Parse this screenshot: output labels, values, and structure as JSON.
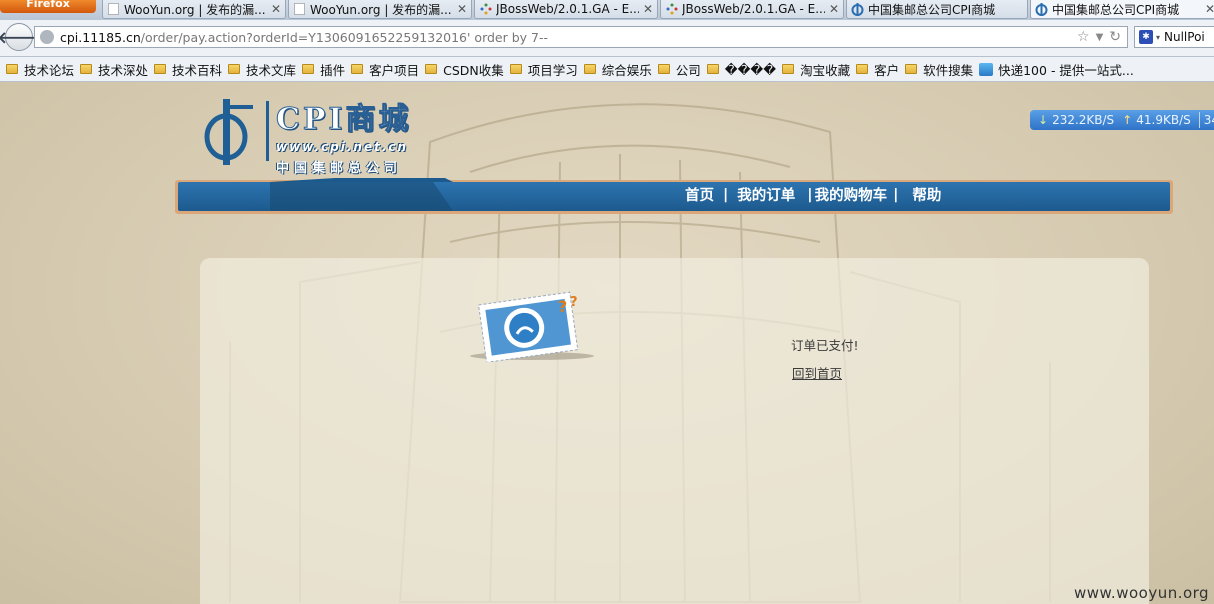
{
  "browser": {
    "menu_button": "Firefox",
    "tabs": [
      {
        "label": "WooYun.org | 发布的漏...",
        "icon": "page-icon"
      },
      {
        "label": "WooYun.org | 发布的漏...",
        "icon": "page-icon"
      },
      {
        "label": "JBossWeb/2.0.1.GA - E...",
        "icon": "loading-icon"
      },
      {
        "label": "JBossWeb/2.0.1.GA - E...",
        "icon": "loading-icon"
      },
      {
        "label": "中国集邮总公司CPI商城",
        "icon": "cpi-logo-icon"
      },
      {
        "label": "中国集邮总公司CPI商城",
        "icon": "cpi-logo-icon"
      }
    ],
    "url_host": "cpi.11185.cn",
    "url_rest": "/order/pay.action?orderId=Y1306091652259132016' order by 7--",
    "search_engine": "NullPoi",
    "bookmarks": [
      "技术论坛",
      "技术深处",
      "技术百科",
      "技术文库",
      "插件",
      "客户项目",
      "CSDN收集",
      "项目学习",
      "综合娱乐",
      "公司",
      "����",
      "淘宝收藏",
      "客户",
      "软件搜集"
    ],
    "bookmark_last": "快递100 - 提供一站式..."
  },
  "speed_indicator": {
    "down": "232.2KB/S",
    "up": "41.9KB/S",
    "extra": "34"
  },
  "site": {
    "logo_title": "CPI商城",
    "logo_url": "www.cpi.net.cn",
    "logo_company": "中国集邮总公司",
    "nav": [
      "首页",
      "我的订单",
      "我的购物车",
      "帮助"
    ]
  },
  "result": {
    "message": "订单已支付!",
    "home_link": "回到首页"
  },
  "watermark": "www.wooyun.org",
  "colors": {
    "nav_blue": "#1f5f95",
    "page_bg": "#d8cdb4",
    "firefox_orange": "#e06a18"
  }
}
